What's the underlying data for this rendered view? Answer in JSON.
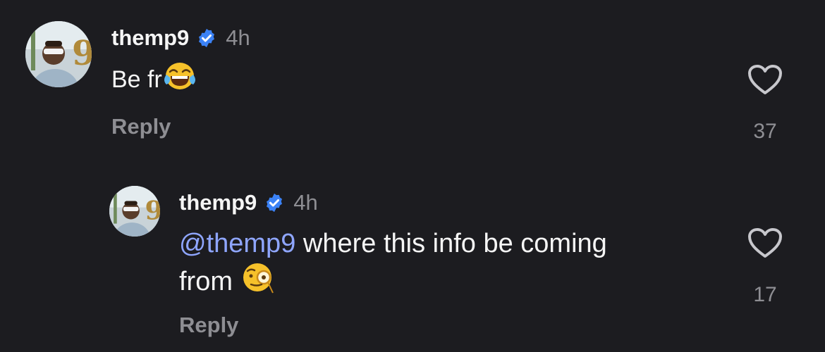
{
  "comments": [
    {
      "username": "themp9",
      "time": "4h",
      "text_before": "Be fr",
      "emoji": "face-with-tears-of-joy",
      "reply_label": "Reply",
      "like_count": "37"
    },
    {
      "username": "themp9",
      "time": "4h",
      "mention": "@themp9",
      "text_line1": " where this info be coming",
      "text_line2": "from ",
      "emoji": "face-with-monocle",
      "reply_label": "Reply",
      "like_count": "17"
    }
  ],
  "colors": {
    "background": "#1c1c20",
    "text": "#f5f5f5",
    "muted": "#8e8e93",
    "mention": "#8fa6ff",
    "verified": "#3b82f6"
  }
}
